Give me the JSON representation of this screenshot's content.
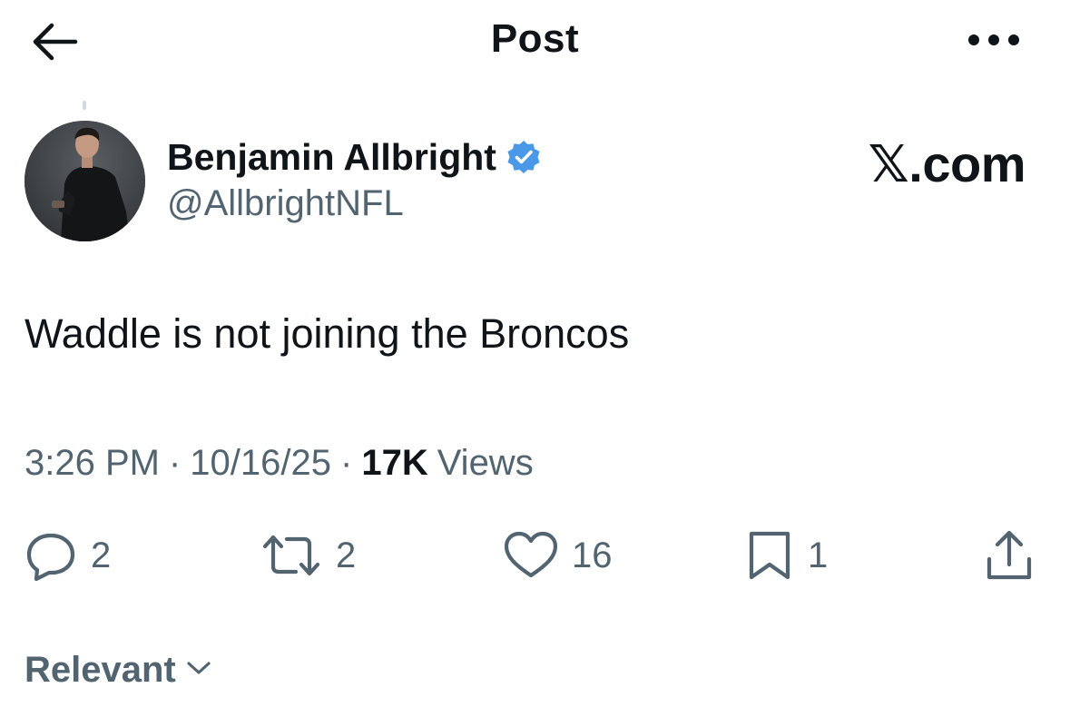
{
  "header": {
    "title": "Post",
    "back_icon": "arrow-left-icon",
    "more_icon": "more-horizontal-icon"
  },
  "author": {
    "display_name": "Benjamin Allbright",
    "handle": "@AllbrightNFL",
    "verified_icon": "verified-badge-icon",
    "verified_color": "#4a99e9"
  },
  "brand": {
    "label": "𝕏.com"
  },
  "post": {
    "text": "Waddle is not joining the Broncos"
  },
  "meta": {
    "time": "3:26 PM",
    "separator": "·",
    "date": "10/16/25",
    "views_count": "17K",
    "views_label": "Views"
  },
  "actions": {
    "reply": {
      "icon": "reply-icon",
      "count": "2"
    },
    "repost": {
      "icon": "repost-icon",
      "count": "2"
    },
    "like": {
      "icon": "heart-icon",
      "count": "16"
    },
    "bookmark": {
      "icon": "bookmark-icon",
      "count": "1"
    },
    "share": {
      "icon": "share-icon"
    }
  },
  "replies_sort": {
    "label": "Relevant",
    "icon": "chevron-down-icon"
  },
  "colors": {
    "text_primary": "#0f1419",
    "text_secondary": "#536471",
    "background": "#ffffff"
  }
}
